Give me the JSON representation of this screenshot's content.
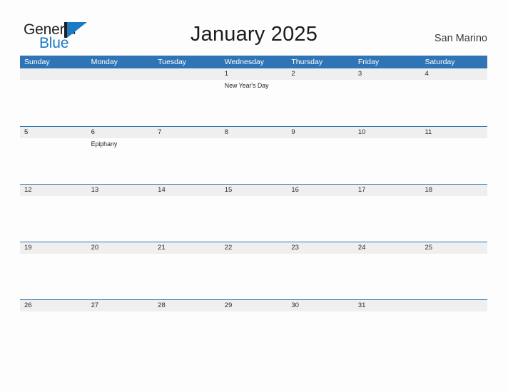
{
  "brand": {
    "name_part1": "General",
    "name_part2": "Blue",
    "logo_icon": "triangle-flag-mark",
    "accent_color": "#1b7ac4"
  },
  "header": {
    "title": "January 2025",
    "location": "San Marino"
  },
  "theme": {
    "header_bar_color": "#2f75b5",
    "row_divider_color": "#2f75b5",
    "date_band_color": "#efefef",
    "page_background": "#fdfdfd",
    "text_color": "#2b2b2b"
  },
  "calendar": {
    "weekdays": [
      "Sunday",
      "Monday",
      "Tuesday",
      "Wednesday",
      "Thursday",
      "Friday",
      "Saturday"
    ],
    "weeks": [
      {
        "days": [
          {
            "number": "",
            "events": []
          },
          {
            "number": "",
            "events": []
          },
          {
            "number": "",
            "events": []
          },
          {
            "number": "1",
            "events": [
              "New Year's Day"
            ]
          },
          {
            "number": "2",
            "events": []
          },
          {
            "number": "3",
            "events": []
          },
          {
            "number": "4",
            "events": []
          }
        ]
      },
      {
        "days": [
          {
            "number": "5",
            "events": []
          },
          {
            "number": "6",
            "events": [
              "Epiphany"
            ]
          },
          {
            "number": "7",
            "events": []
          },
          {
            "number": "8",
            "events": []
          },
          {
            "number": "9",
            "events": []
          },
          {
            "number": "10",
            "events": []
          },
          {
            "number": "11",
            "events": []
          }
        ]
      },
      {
        "days": [
          {
            "number": "12",
            "events": []
          },
          {
            "number": "13",
            "events": []
          },
          {
            "number": "14",
            "events": []
          },
          {
            "number": "15",
            "events": []
          },
          {
            "number": "16",
            "events": []
          },
          {
            "number": "17",
            "events": []
          },
          {
            "number": "18",
            "events": []
          }
        ]
      },
      {
        "days": [
          {
            "number": "19",
            "events": []
          },
          {
            "number": "20",
            "events": []
          },
          {
            "number": "21",
            "events": []
          },
          {
            "number": "22",
            "events": []
          },
          {
            "number": "23",
            "events": []
          },
          {
            "number": "24",
            "events": []
          },
          {
            "number": "25",
            "events": []
          }
        ]
      },
      {
        "days": [
          {
            "number": "26",
            "events": []
          },
          {
            "number": "27",
            "events": []
          },
          {
            "number": "28",
            "events": []
          },
          {
            "number": "29",
            "events": []
          },
          {
            "number": "30",
            "events": []
          },
          {
            "number": "31",
            "events": []
          },
          {
            "number": "",
            "events": []
          }
        ]
      }
    ]
  }
}
